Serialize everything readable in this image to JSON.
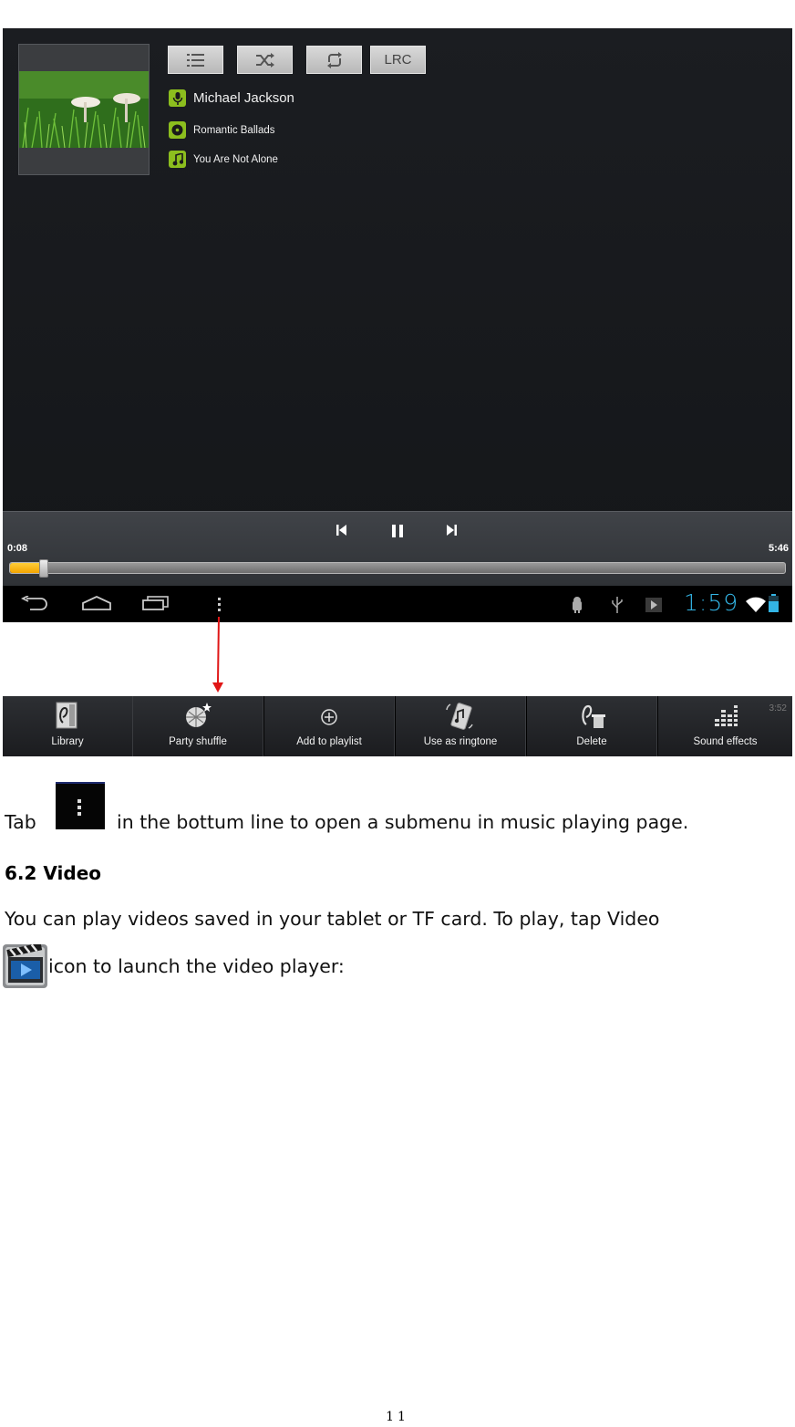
{
  "player": {
    "top_buttons": [
      "list-icon",
      "shuffle-icon",
      "repeat-icon",
      "LRC"
    ],
    "artist": "Michael Jackson",
    "album": "Romantic Ballads",
    "song": "You Are Not Alone",
    "time_current": "0:08",
    "time_total": "5:46",
    "progress": 0.023,
    "clock": "1:59",
    "accent": "#8cbe1e",
    "clock_color": "#33b5e5",
    "seek_color": "#f3a400"
  },
  "menu": {
    "ghost_time": "3:52",
    "items": [
      {
        "label": "Library",
        "icon": "library-icon"
      },
      {
        "label": "Party shuffle",
        "icon": "party-shuffle-icon"
      },
      {
        "label": "Add to playlist",
        "icon": "add-icon"
      },
      {
        "label": "Use as ringtone",
        "icon": "ringtone-icon"
      },
      {
        "label": "Delete",
        "icon": "delete-icon"
      },
      {
        "label": "Sound effects",
        "icon": "equalizer-icon"
      }
    ]
  },
  "text": {
    "tab_prefix": "Tab",
    "tab_suffix": "in the bottum line to open a submenu in music playing page.",
    "heading": "6.2 Video",
    "para1": "You can play videos saved in your tablet or TF card. To play, tap Video",
    "para2": "icon to launch the video player:",
    "page_number": "11"
  }
}
